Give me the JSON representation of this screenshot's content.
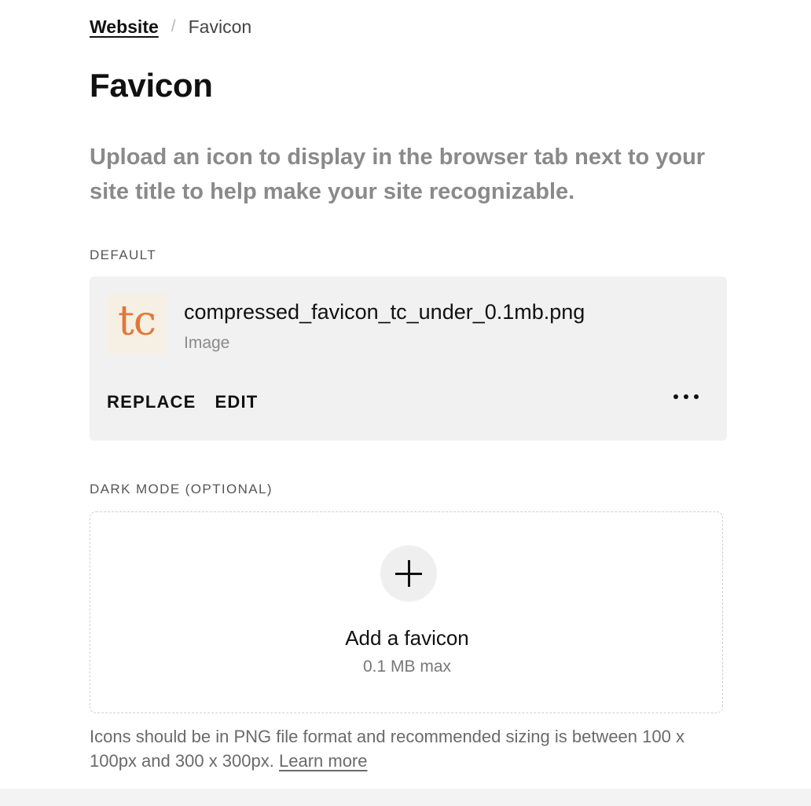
{
  "breadcrumb": {
    "parent": "Website",
    "separator": "/",
    "current": "Favicon"
  },
  "page": {
    "title": "Favicon",
    "description": "Upload an icon to display in the browser tab next to your site title to help make your site recognizable."
  },
  "default_section": {
    "label": "DEFAULT",
    "file": {
      "thumbnail_text": "tc",
      "name": "compressed_favicon_tc_under_0.1mb.png",
      "type": "Image"
    },
    "actions": {
      "replace": "REPLACE",
      "edit": "EDIT",
      "more_icon": "more-horizontal-icon"
    },
    "colors": {
      "thumb_bg": "#f6efe3",
      "thumb_text": "#e0783a",
      "card_bg": "#f1f1f1"
    }
  },
  "dark_section": {
    "label": "DARK MODE (OPTIONAL)",
    "upload": {
      "icon": "plus-icon",
      "title": "Add a favicon",
      "subtitle": "0.1 MB max"
    }
  },
  "help": {
    "text": "Icons should be in PNG file format and recommended sizing is between 100 x 100px and 300 x 300px.",
    "link": "Learn more"
  }
}
